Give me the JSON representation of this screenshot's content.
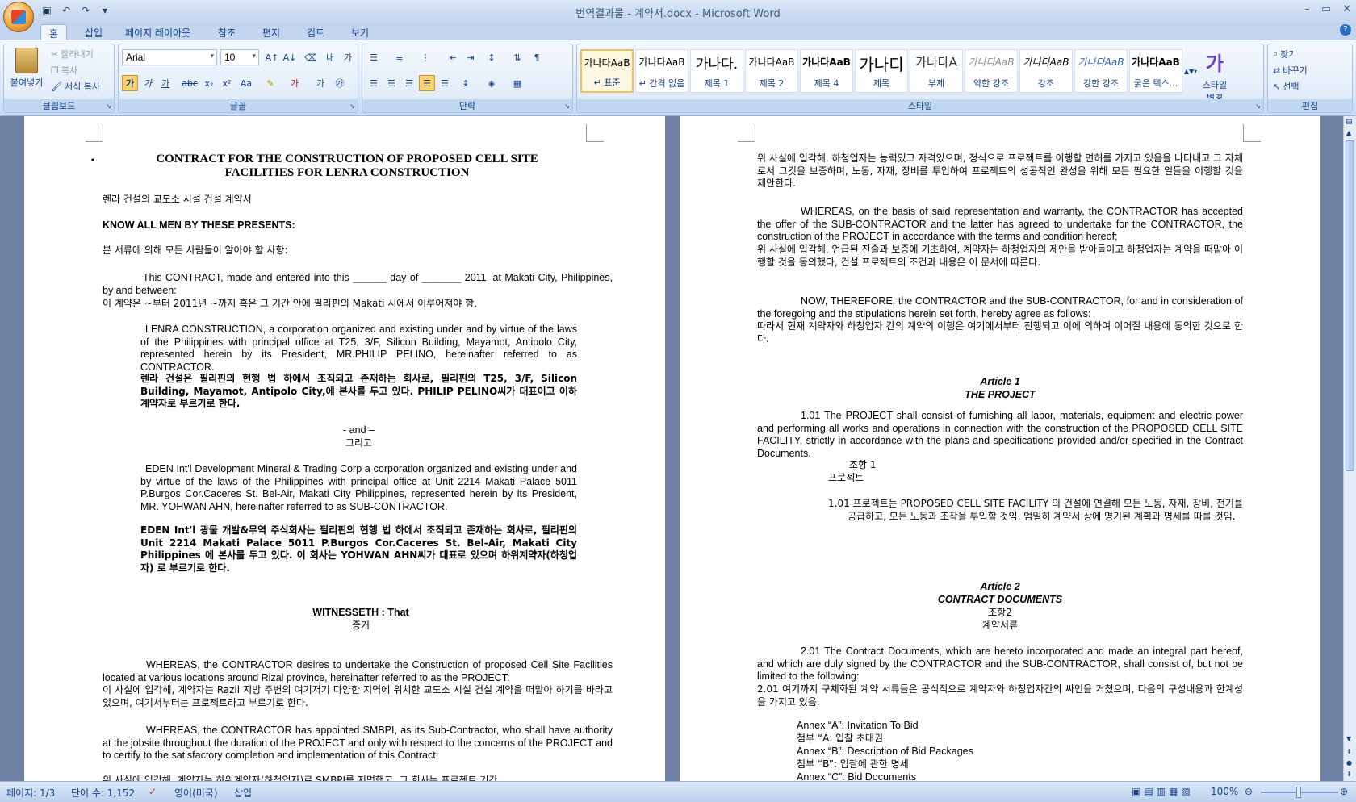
{
  "window": {
    "title": "번역결과물 - 계약서.docx - Microsoft Word",
    "controls": [
      "–",
      "▭",
      "✕"
    ]
  },
  "tabs": [
    {
      "label": "홈"
    },
    {
      "label": "삽입"
    },
    {
      "label": "페이지 레이아웃"
    },
    {
      "label": "참조"
    },
    {
      "label": "편지"
    },
    {
      "label": "검토"
    },
    {
      "label": "보기"
    }
  ],
  "ribbon": {
    "clipboard": {
      "label": "클립보드",
      "paste": "붙여넣기",
      "cut": "잘라내기",
      "copy": "복사",
      "format_painter": "서식 복사"
    },
    "font": {
      "label": "글꼴",
      "font_name": "Arial",
      "font_size": "10"
    },
    "paragraph": {
      "label": "단락"
    },
    "styles": {
      "label": "스타일",
      "change_styles": "스타일 변경",
      "tiles": [
        {
          "sample": "가나다AaB",
          "name": "↵ 표준"
        },
        {
          "sample": "가나다AaB",
          "name": "↵ 간격 없음"
        },
        {
          "sample": "가나다.",
          "name": "제목 1"
        },
        {
          "sample": "가나다AaB",
          "name": "제목 2"
        },
        {
          "sample": "가나다AaB",
          "name": "제목 4"
        },
        {
          "sample": "가나디",
          "name": "제목"
        },
        {
          "sample": "가나다A",
          "name": "부제"
        },
        {
          "sample": "가나다AaB",
          "name": "약한 강조"
        },
        {
          "sample": "가나다AaB",
          "name": "강조"
        },
        {
          "sample": "가나다AaB",
          "name": "강한 강조"
        },
        {
          "sample": "가나다AaB",
          "name": "굵은 텍스..."
        }
      ]
    },
    "editing": {
      "label": "편집",
      "find": "찾기",
      "replace": "바꾸기",
      "select": "선택"
    }
  },
  "doc_left": {
    "title1": "CONTRACT FOR THE CONSTRUCTION OF PROPOSED CELL SITE",
    "title2": "FACILITIES FOR LENRA CONSTRUCTION",
    "ko_title": "렌라 건설의 교도소 시설 건설 계약서",
    "know_all": "KNOW ALL MEN BY THESE PRESENTS:",
    "ko_know_all": "본 서류에 의해 모든 사람들이 알아야 할 사항:",
    "contract_made": "This CONTRACT, made and entered into this ______ day of _______ 2011, at Makati City, Philippines, by and between:",
    "ko_contract_made": "이 계약은 ~부터 2011년 ~까지 혹은 그 기간 안에 필리핀의 Makati 시에서 이루어져야 함.",
    "lenra": "LENRA CONSTRUCTION, a corporation organized and existing under and by virtue of the laws of the Philippines with principal office at T25, 3/F, Silicon Building, Mayamot, Antipolo City, represented herein by its President, MR.PHILIP PELINO, hereinafter referred to as CONTRACTOR.",
    "ko_lenra": "렌라 건설은 필리핀의 현행 법 하에서 조직되고 존재하는 회사로, 필리핀의 T25, 3/F, Silicon Building, Mayamot, Antipolo City,에 본사를 두고 있다. PHILIP PELINO씨가 대표이고 이하 계약자로 부르기로 한다.",
    "and": "- and –",
    "ko_and": "그리고",
    "eden": "EDEN Int'l Development Mineral & Trading Corp a corporation organized and existing under and by virtue of the laws of the Philippines with principal office at Unit 2214 Makati Palace 5011 P.Burgos Cor.Caceres St. Bel-Air, Makati City Philippines, represented herein by its President, MR. YOHWAN AHN, hereinafter referred to as SUB-CONTRACTOR.",
    "ko_eden": "EDEN Int'l 광물 개발&무역 주식회사는 필리핀의 현행 법 하에서 조직되고 존재하는 회사로, 필리핀의 Unit 2214 Makati Palace 5011 P.Burgos Cor.Caceres St. Bel-Air, Makati City Philippines 에 본사를 두고 있다. 이 회사는 YOHWAN AHN씨가 대표로 있으며 하위계약자(하청업자) 로 부르기로 한다.",
    "witnesseth": "WITNESSETH : That",
    "ko_witnesseth": "증거",
    "whereas1": "WHEREAS, the CONTRACTOR desires to undertake the Construction of proposed Cell Site Facilities located at various locations around Rizal province, hereinafter referred to as the PROJECT;",
    "ko_whereas1": "이 사실에 입각해, 계약자는 Razil 지방 주변의 여기저기 다양한 지역에 위치한 교도소 시설 건설 계약을 떠맡아 하기를 바라고 있으며, 여기서부터는 프로젝트라고 부르기로 한다.",
    "whereas2": "WHEREAS, the CONTRACTOR has appointed SMBPI, as its Sub-Contractor, who shall have authority at the jobsite throughout the duration of the PROJECT and only with respect to the concerns of the PROJECT and to certify to the satisfactory completion and implementation of this Contract;",
    "ko_whereas2": "위 사실에 입각해, 계약자는 하위계약자(하청업자)로 SMBPI를 지명했고, 그 회사는 프로젝트 기간"
  },
  "doc_right": {
    "ko_top": "위 사실에 입각해, 하청업자는 능력있고 자격있으며, 정식으로 프로젝트를 이행할 면허를 가지고 있음을 나타내고 그 자체로서 그것을 보증하며, 노동, 자재, 장비를 투입하여 프로젝트의 성공적인 완성을 위해 모든 필요한 일들을 이행할 것을 제안한다.",
    "whereas3": "WHEREAS, on the basis of said representation and warranty, the CONTRACTOR has accepted the offer of the SUB-CONTRACTOR and the latter has agreed to undertake for the CONTRACTOR, the construction of the PROJECT in accordance with the terms and condition hereof;",
    "ko_whereas3": "위 사실에 입각해, 언급된 진술과 보증에 기초하여, 계약자는 하청업자의 제안을 받아들이고 하청업자는 계약을 떠맡아 이행할 것을 동의했다, 건설 프로젝트의 조건과 내용은 이 문서에 따른다.",
    "now_therefore": "NOW, THEREFORE, the CONTRACTOR and the SUB-CONTRACTOR, for and in consideration of the foregoing and the stipulations herein set forth, hereby agree as follows:",
    "ko_now_therefore": "따라서 현재 계약자와 하청업자 간의 계약의 이행은 여기에서부터 진행되고 이에 의하여 이어질 내용에 동의한 것으로 한다.",
    "article1": "Article 1",
    "article1_title": "THE PROJECT",
    "p101": "1.01 The PROJECT shall consist of furnishing all labor, materials, equipment and electric power and performing all works and operations in connection with the construction of the PROPOSED CELL SITE FACILITY, strictly in accordance with the plans and specifications provided and/or specified in the Contract Documents.",
    "ko_article1": "조항 1",
    "ko_article1_title": "프로젝트",
    "ko_p101": "1.01 프로젝트는 PROPOSED CELL SITE FACILITY 의 건설에 연결해 모든 노동, 자재, 장비, 전기를 공급하고, 모든 노동과 조작을 투입할 것임, 엄밀히 계약서 상에 명기된 계획과 명세를 따를 것임.",
    "article2": "Article 2",
    "article2_title": "CONTRACT DOCUMENTS",
    "ko_article2": "조항2",
    "ko_article2_title": "계약서류",
    "p201": "2.01 The Contract Documents, which are hereto incorporated and made an integral part hereof, and which are duly signed by the CONTRACTOR and the SUB-CONTRACTOR, shall consist of, but not be limited to the following:",
    "ko_p201": "2.01 여기까지 구체화된 계약 서류들은 공식적으로 계약자와 하청업자간의 싸인을 거쳤으며, 다음의 구성내용과 한계성을 가지고 있음.",
    "annex_a": "Annex “A”: Invitation To Bid",
    "ko_annex_a": "첨부 “A: 입찰 초대권",
    "annex_b": "Annex “B”: Description of Bid Packages",
    "ko_annex_b": "첨부 “B”: 입찰에 관한 명세",
    "annex_c": "Annex “C”: Bid Documents"
  },
  "status": {
    "page": "페이지: 1/3",
    "words": "단어 수: 1,152",
    "language": "영어(미국)",
    "mode": "삽입",
    "zoom": "100%"
  }
}
